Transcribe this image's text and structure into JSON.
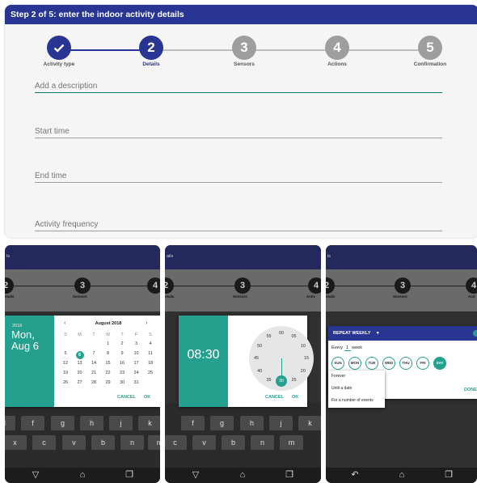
{
  "wizard": {
    "header": "Step 2 of 5: enter the indoor activity details",
    "steps": [
      {
        "num": "",
        "label": "Activity type",
        "state": "done"
      },
      {
        "num": "2",
        "label": "Details",
        "state": "active"
      },
      {
        "num": "3",
        "label": "Sensors",
        "state": "pending"
      },
      {
        "num": "4",
        "label": "Actions",
        "state": "pending"
      },
      {
        "num": "5",
        "label": "Confirmation",
        "state": "pending"
      }
    ],
    "fields": {
      "description": "Add a description",
      "start_time": "Start time",
      "end_time": "End time",
      "frequency": "Activity frequency"
    }
  },
  "phone_common": {
    "status_text": "ails",
    "status_text_short": "ls",
    "step2_label": "etails",
    "step3_label": "Sensors",
    "step4_label": "Acti",
    "step4_label_p2": "Activ",
    "step2_num": "2",
    "step3_num": "3",
    "step4_num": "4",
    "kb_row1": [
      "d",
      "f",
      "g",
      "h",
      "j",
      "k"
    ],
    "kb_row2": [
      "x",
      "c",
      "v",
      "b",
      "n",
      "m"
    ],
    "kb_row1_p2": [
      "f",
      "g",
      "h",
      "j",
      "k",
      "l"
    ],
    "kb_row2_p2": [
      "c",
      "v",
      "b",
      "n",
      "m"
    ]
  },
  "date_picker": {
    "year": "2018",
    "day_label": "Mon,",
    "date_label": "Aug 6",
    "month_title": "August 2018",
    "weekdays": [
      "S",
      "M",
      "T",
      "W",
      "T",
      "F",
      "S"
    ],
    "weeks": [
      [
        "",
        "",
        "",
        "1",
        "2",
        "3",
        "4"
      ],
      [
        "5",
        "6",
        "7",
        "8",
        "9",
        "10",
        "11"
      ],
      [
        "12",
        "13",
        "14",
        "15",
        "16",
        "17",
        "18"
      ],
      [
        "19",
        "20",
        "21",
        "22",
        "23",
        "24",
        "25"
      ],
      [
        "26",
        "27",
        "28",
        "29",
        "30",
        "31",
        ""
      ]
    ],
    "selected_day": "6",
    "cancel": "CANCEL",
    "ok": "OK"
  },
  "time_picker": {
    "time": "08:30",
    "minutes": [
      "00",
      "05",
      "10",
      "15",
      "20",
      "25",
      "30",
      "35",
      "40",
      "45",
      "50",
      "55"
    ],
    "selected_minute": "30",
    "cancel": "CANCEL",
    "ok": "OK"
  },
  "repeat": {
    "title": "REPEAT WEEKLY",
    "every_label": "Every",
    "every_value": "1",
    "unit": "week",
    "days": [
      "SUN",
      "MON",
      "TUE",
      "WED",
      "THU",
      "FRI",
      "SAT"
    ],
    "selected_day": "SAT",
    "menu": [
      "Forever",
      "Until a date",
      "For a number of events"
    ],
    "done": "DONE"
  },
  "colors": {
    "primary": "#283593",
    "accent": "#26a08e",
    "inactive": "#9e9e9e"
  }
}
